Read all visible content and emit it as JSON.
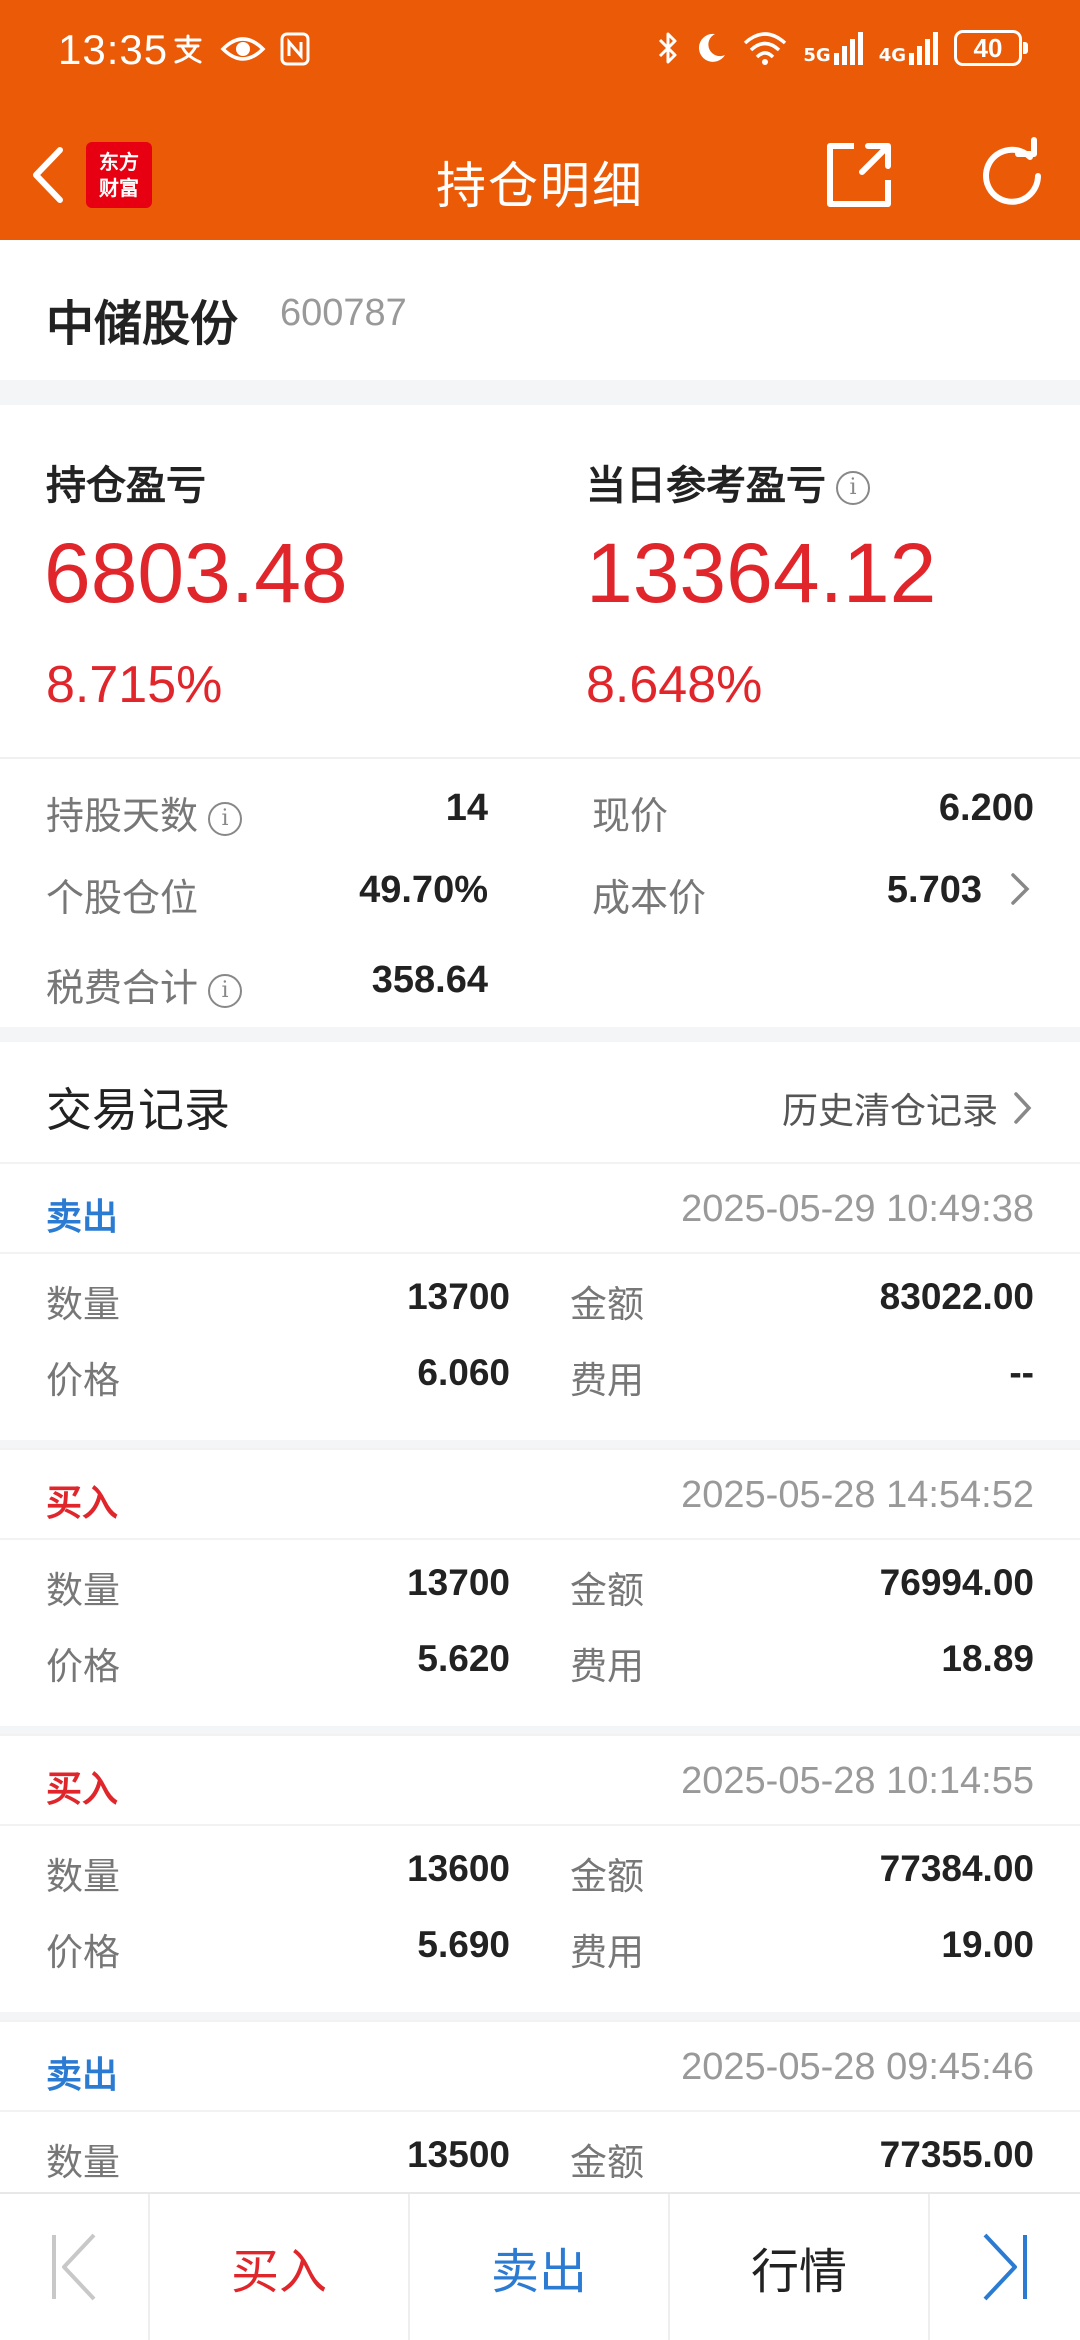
{
  "status_bar": {
    "time": "13:35",
    "net_5g": "5G",
    "net_4g": "4G",
    "battery": "40"
  },
  "nav": {
    "logo_line1": "东方",
    "logo_line2": "财富",
    "title": "持仓明细"
  },
  "stock": {
    "name": "中储股份",
    "code": "600787"
  },
  "summary": {
    "holding_pl_label": "持仓盈亏",
    "holding_pl_value": "6803.48",
    "holding_pl_pct": "8.715%",
    "daily_pl_label": "当日参考盈亏",
    "daily_pl_value": "13364.12",
    "daily_pl_pct": "8.648%",
    "info_glyph": "i",
    "holding_days_label": "持股天数",
    "holding_days_value": "14",
    "position_ratio_label": "个股仓位",
    "position_ratio_value": "49.70%",
    "fees_label": "税费合计",
    "fees_value": "358.64",
    "current_price_label": "现价",
    "current_price_value": "6.200",
    "cost_price_label": "成本价",
    "cost_price_value": "5.703"
  },
  "trades": {
    "title": "交易记录",
    "history_link": "历史清仓记录",
    "qty_label": "数量",
    "price_label": "价格",
    "amount_label": "金额",
    "fee_label": "费用",
    "records": [
      {
        "side": "卖出",
        "type": "sell",
        "time": "2025-05-29 10:49:38",
        "qty": "13700",
        "price": "6.060",
        "amount": "83022.00",
        "fee": "--"
      },
      {
        "side": "买入",
        "type": "buy",
        "time": "2025-05-28 14:54:52",
        "qty": "13700",
        "price": "5.620",
        "amount": "76994.00",
        "fee": "18.89"
      },
      {
        "side": "买入",
        "type": "buy",
        "time": "2025-05-28 10:14:55",
        "qty": "13600",
        "price": "5.690",
        "amount": "77384.00",
        "fee": "19.00"
      },
      {
        "side": "卖出",
        "type": "sell",
        "time": "2025-05-28 09:45:46",
        "qty": "13500",
        "price": "",
        "amount": "77355.00",
        "fee": ""
      }
    ]
  },
  "bottom_bar": {
    "buy": "买入",
    "sell": "卖出",
    "quote": "行情"
  },
  "colors": {
    "header_bg": "#EB5A07",
    "profit_red": "#E0252B",
    "sell_blue": "#2B7BD3"
  }
}
